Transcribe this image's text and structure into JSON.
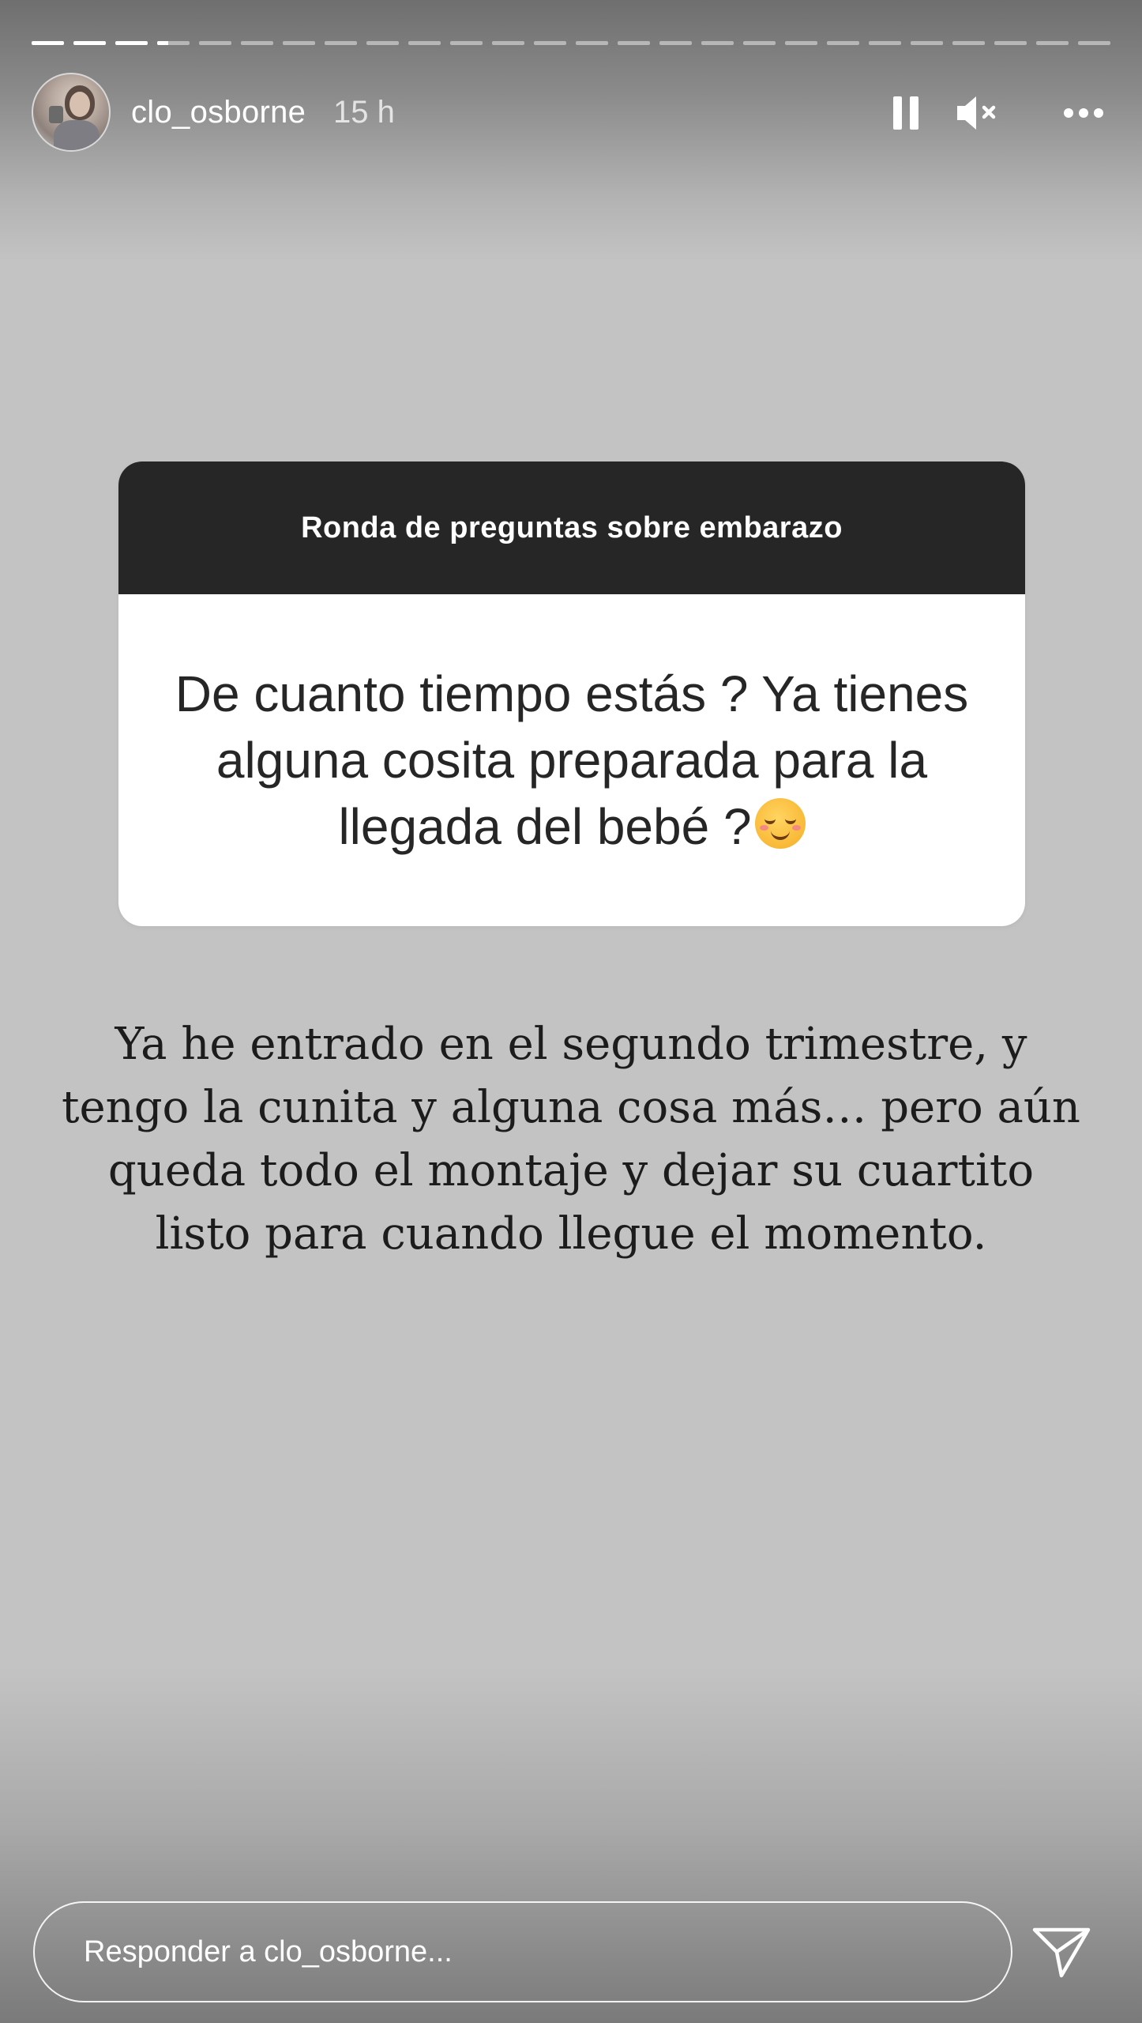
{
  "story": {
    "progress_segments": [
      {
        "fill": 1.0
      },
      {
        "fill": 1.0
      },
      {
        "fill": 1.0
      },
      {
        "fill": 0.35
      },
      {
        "fill": 0
      },
      {
        "fill": 0
      },
      {
        "fill": 0
      },
      {
        "fill": 0
      },
      {
        "fill": 0
      },
      {
        "fill": 0
      },
      {
        "fill": 0
      },
      {
        "fill": 0
      },
      {
        "fill": 0
      },
      {
        "fill": 0
      },
      {
        "fill": 0
      },
      {
        "fill": 0
      },
      {
        "fill": 0
      },
      {
        "fill": 0
      },
      {
        "fill": 0
      },
      {
        "fill": 0
      },
      {
        "fill": 0
      },
      {
        "fill": 0
      },
      {
        "fill": 0
      },
      {
        "fill": 0
      },
      {
        "fill": 0
      },
      {
        "fill": 0
      }
    ]
  },
  "header": {
    "username": "clo_osborne",
    "timestamp": "15 h",
    "icons": {
      "avatar": "profile-avatar",
      "pause": "pause-icon",
      "mute": "speaker-muted-icon",
      "more": "more-options-icon"
    }
  },
  "question_sticker": {
    "title": "Ronda de preguntas sobre embarazo",
    "question": "De cuanto tiempo estás ? Ya tienes alguna cosita preparada para la llegada del bebé ?",
    "emoji": "smiling-face-icon"
  },
  "answer": {
    "text": "Ya he entrado en el segundo trimestre, y tengo la cunita y alguna cosa más… pero aún queda todo el montaje y dejar su cuartito listo para cuando llegue el momento."
  },
  "reply": {
    "placeholder": "Responder a clo_osborne...",
    "send_icon": "send-paper-plane-icon"
  },
  "colors": {
    "background": "#c3c3c3",
    "sticker_header": "#262626",
    "sticker_body": "#ffffff",
    "text_dark": "#262626"
  }
}
